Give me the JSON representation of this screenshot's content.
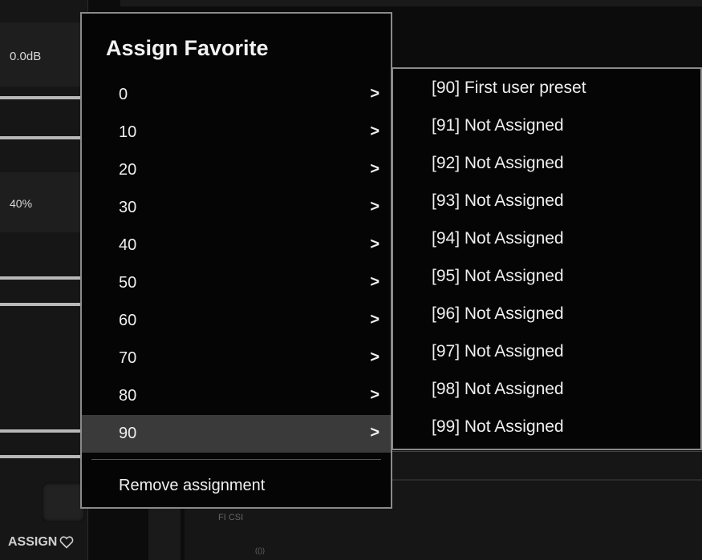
{
  "background": {
    "level_value": "0.0dB",
    "percent_value": "40%",
    "assign_label": "ASSIGN",
    "small_label_1": "FI   CSI",
    "small_label_2": "(())"
  },
  "menu": {
    "title": "Assign Favorite",
    "items": [
      {
        "label": "0",
        "arrow": ">"
      },
      {
        "label": "10",
        "arrow": ">"
      },
      {
        "label": "20",
        "arrow": ">"
      },
      {
        "label": "30",
        "arrow": ">"
      },
      {
        "label": "40",
        "arrow": ">"
      },
      {
        "label": "50",
        "arrow": ">"
      },
      {
        "label": "60",
        "arrow": ">"
      },
      {
        "label": "70",
        "arrow": ">"
      },
      {
        "label": "80",
        "arrow": ">"
      },
      {
        "label": "90",
        "arrow": ">"
      }
    ],
    "selected_item": "90",
    "remove_label": "Remove assignment"
  },
  "submenu": {
    "items": [
      {
        "label": "[90] First user preset"
      },
      {
        "label": "[91] Not Assigned"
      },
      {
        "label": "[92] Not Assigned"
      },
      {
        "label": "[93] Not Assigned"
      },
      {
        "label": "[94] Not Assigned"
      },
      {
        "label": "[95] Not Assigned"
      },
      {
        "label": "[96] Not Assigned"
      },
      {
        "label": "[97] Not Assigned"
      },
      {
        "label": "[98] Not Assigned"
      },
      {
        "label": "[99] Not Assigned"
      }
    ]
  },
  "colors": {
    "menu_background": "#050505",
    "menu_border": "#8a8a8a",
    "selected_background": "#3a3a3a",
    "text": "#efefef"
  }
}
